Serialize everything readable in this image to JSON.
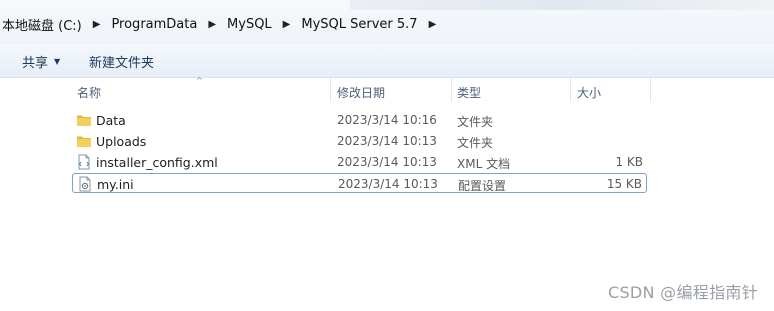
{
  "breadcrumb": {
    "items": [
      "本地磁盘 (C:)",
      "ProgramData",
      "MySQL",
      "MySQL Server 5.7"
    ],
    "separator": "▶"
  },
  "toolbar": {
    "share_label": "共享",
    "share_dropdown": "▼",
    "new_folder_label": "新建文件夹"
  },
  "columns": {
    "name": "名称",
    "date": "修改日期",
    "type": "类型",
    "size": "大小",
    "sort_indicator": "^"
  },
  "files": [
    {
      "name": "Data",
      "date": "2023/3/14 10:16",
      "type": "文件夹",
      "size": "",
      "icon": "folder-icon"
    },
    {
      "name": "Uploads",
      "date": "2023/3/14 10:13",
      "type": "文件夹",
      "size": "",
      "icon": "folder-icon"
    },
    {
      "name": "installer_config.xml",
      "date": "2023/3/14 10:13",
      "type": "XML 文档",
      "size": "1 KB",
      "icon": "xml-file-icon"
    },
    {
      "name": "my.ini",
      "date": "2023/3/14 10:13",
      "type": "配置设置",
      "size": "15 KB",
      "icon": "ini-file-icon"
    }
  ],
  "watermark": "CSDN @编程指南针",
  "colors": {
    "folder": "#e8b83a",
    "selection_border": "#7da2ce",
    "toolbar_text": "#1e395b",
    "header_text": "#4c607a"
  }
}
